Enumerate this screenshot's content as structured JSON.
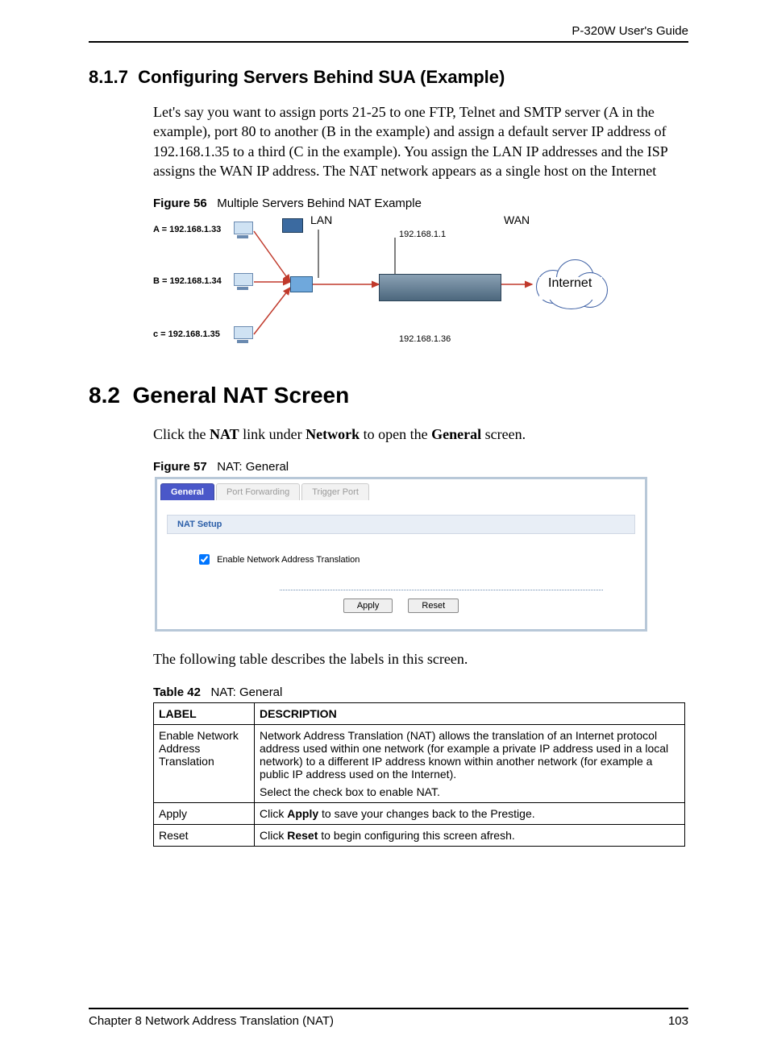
{
  "header": {
    "guide_title": "P-320W User's Guide"
  },
  "section_817": {
    "number": "8.1.7",
    "title": "Configuring Servers Behind SUA (Example)",
    "para": "Let's say you want to assign ports 21-25 to one FTP, Telnet and SMTP server (A in the example), port 80 to another (B in the example) and assign a default server IP address of 192.168.1.35 to a third (C in the example). You assign the LAN IP addresses and the ISP assigns the WAN IP address. The NAT network appears as a single host on the Internet"
  },
  "figure56": {
    "label_prefix": "Figure 56",
    "caption": "Multiple Servers Behind NAT Example",
    "lan": "LAN",
    "wan": "WAN",
    "gateway_ip": "192.168.1.1",
    "host_a": "A = 192.168.1.33",
    "host_b": "B = 192.168.1.34",
    "host_c": "c = 192.168.1.35",
    "inside_ip": "192.168.1.36",
    "internet": "Internet"
  },
  "section_82": {
    "number": "8.2",
    "title": "General NAT Screen",
    "intro_pre": "Click the ",
    "intro_nat": "NAT",
    "intro_mid": " link under ",
    "intro_network": "Network",
    "intro_mid2": " to open the ",
    "intro_general": "General",
    "intro_post": " screen."
  },
  "figure57": {
    "label_prefix": "Figure 57",
    "caption": "NAT: General",
    "tabs": {
      "general": "General",
      "port_forwarding": "Port Forwarding",
      "trigger_port": "Trigger Port"
    },
    "panel_header": "NAT Setup",
    "checkbox_label": "Enable Network Address Translation",
    "apply": "Apply",
    "reset": "Reset"
  },
  "after_fig57": "The following table describes the labels in this screen.",
  "table42": {
    "label_prefix": "Table 42",
    "caption": "NAT: General",
    "headers": {
      "label": "LABEL",
      "description": "DESCRIPTION"
    },
    "rows": [
      {
        "label": "Enable Network Address Translation",
        "desc1": "Network Address Translation (NAT) allows the translation of an Internet protocol address used within one network (for example a private IP address used in a local network) to a different IP address known within another network (for example a public IP address used on the Internet).",
        "desc2": "Select the check box to enable NAT."
      },
      {
        "label": "Apply",
        "desc_pre": "Click ",
        "desc_bold": "Apply",
        "desc_post": " to save your changes back to the Prestige."
      },
      {
        "label": "Reset",
        "desc_pre": "Click ",
        "desc_bold": "Reset",
        "desc_post": " to begin configuring this screen afresh."
      }
    ]
  },
  "footer": {
    "chapter": "Chapter 8 Network Address Translation (NAT)",
    "page": "103"
  }
}
